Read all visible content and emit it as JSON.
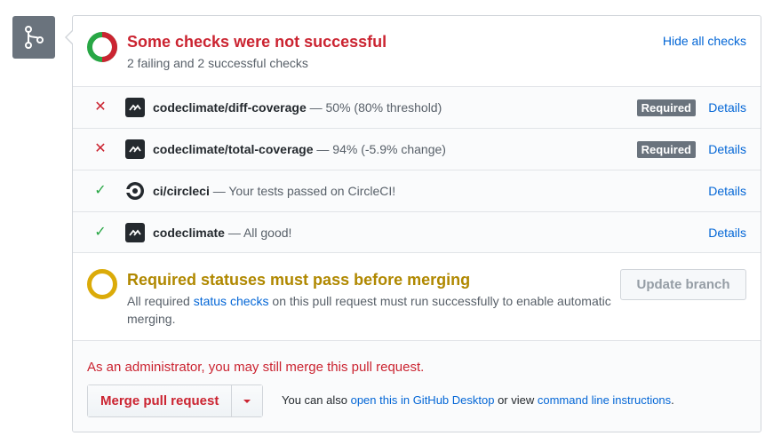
{
  "icons": {
    "git_merge": "git-merge-icon",
    "fail": "x-icon",
    "success": "check-icon",
    "codeclimate": "codeclimate-logo-icon",
    "circleci": "circleci-logo-icon"
  },
  "colors": {
    "fail": "#cb2431",
    "success": "#28a745",
    "pending": "#dbab09",
    "link": "#0366d6"
  },
  "summary": {
    "title": "Some checks were not successful",
    "subtitle": "2 failing and 2 successful checks",
    "toggle_label": "Hide all checks",
    "failing": 2,
    "successful": 2
  },
  "checks": [
    {
      "status": "fail",
      "status_glyph": "✕",
      "name": "codeclimate/diff-coverage",
      "description": " — 50% (80% threshold)",
      "required_label": "Required",
      "details_label": "Details",
      "avatar": "codeclimate"
    },
    {
      "status": "fail",
      "status_glyph": "✕",
      "name": "codeclimate/total-coverage",
      "description": " — 94% (-5.9% change)",
      "required_label": "Required",
      "details_label": "Details",
      "avatar": "codeclimate"
    },
    {
      "status": "success",
      "status_glyph": "✓",
      "name": "ci/circleci",
      "description": " — Your tests passed on CircleCI!",
      "required_label": "",
      "details_label": "Details",
      "avatar": "circleci"
    },
    {
      "status": "success",
      "status_glyph": "✓",
      "name": "codeclimate",
      "description": " — All good!",
      "required_label": "",
      "details_label": "Details",
      "avatar": "codeclimate"
    }
  ],
  "merge_status": {
    "title": "Required statuses must pass before merging",
    "desc_before": "All required ",
    "desc_link": "status checks",
    "desc_after": " on this pull request must run successfully to enable automatic merging.",
    "update_button": "Update branch"
  },
  "merge": {
    "admin_note": "As an administrator, you may still merge this pull request.",
    "button_label": "Merge pull request",
    "alt_prefix": "You can also ",
    "alt_link_desktop": "open this in GitHub Desktop",
    "alt_middle": " or view ",
    "alt_link_cli": "command line instructions",
    "alt_suffix": "."
  }
}
